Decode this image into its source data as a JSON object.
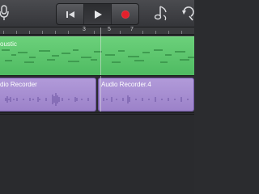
{
  "toolbar": {
    "icons": [
      "microphone-icon",
      "rewind-icon",
      "play-icon",
      "record-icon",
      "instrument-note-icon",
      "loop-icon"
    ],
    "colors": {
      "record": "#e3202c"
    }
  },
  "ruler": {
    "marks": [
      "3",
      "5",
      "7"
    ]
  },
  "tracks": {
    "green_region": {
      "label": "oustic",
      "color": "#5cc46c"
    },
    "purple_regions": [
      {
        "label": "dio Recorder",
        "color": "#a78fd2"
      },
      {
        "label": "Audio Recorder.4",
        "color": "#a78fd2"
      }
    ]
  }
}
